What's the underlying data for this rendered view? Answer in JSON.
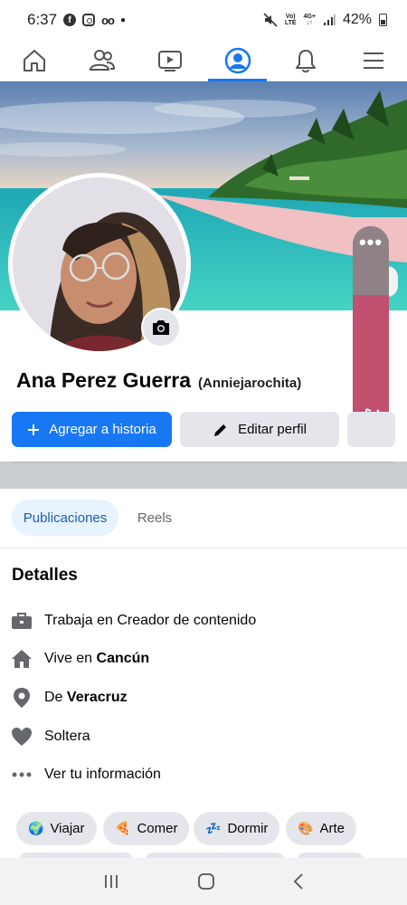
{
  "status": {
    "time": "6:37",
    "battery": "42%"
  },
  "nav": {
    "items": [
      "home",
      "friends",
      "watch",
      "profile",
      "notifications",
      "menu"
    ],
    "active": "profile"
  },
  "profile": {
    "name": "Ana Perez Guerra",
    "username": "(Anniejarochita)"
  },
  "actions": {
    "add_story": "Agregar a historia",
    "edit_profile": "Editar perfil"
  },
  "tabs": [
    {
      "label": "Publicaciones",
      "active": true
    },
    {
      "label": "Reels",
      "active": false
    }
  ],
  "details": {
    "title": "Detalles",
    "work_prefix": "Trabaja en ",
    "work_value": "Creador de contenido",
    "lives_prefix": "Vive en ",
    "lives_value": "Cancún",
    "from_prefix": "De ",
    "from_value": "Veracruz",
    "relationship": "Soltera",
    "see_info": "Ver tu información"
  },
  "hobbies": [
    {
      "emoji": "🌍",
      "label": "Viajar"
    },
    {
      "emoji": "🍕",
      "label": "Comer"
    },
    {
      "emoji": "💤",
      "label": "Dormir"
    },
    {
      "emoji": "🎨",
      "label": "Arte"
    }
  ],
  "colors": {
    "brand": "#1877f2",
    "volume": "#c0506e"
  }
}
